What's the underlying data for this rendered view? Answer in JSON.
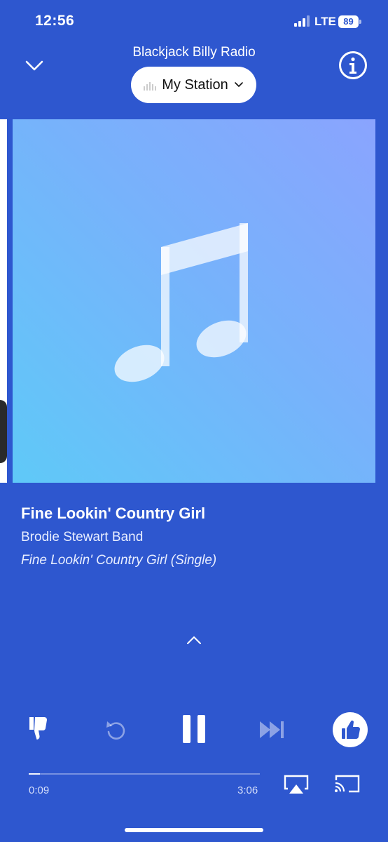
{
  "status_bar": {
    "time": "12:56",
    "network": "LTE",
    "battery": "89"
  },
  "header": {
    "station_name": "Blackjack Billy Radio",
    "station_selector": "My Station"
  },
  "artwork": {
    "icon": "music-note-icon",
    "gradient_start": "#5FC9F8",
    "gradient_end": "#8AA4FE"
  },
  "track": {
    "title": "Fine Lookin' Country Girl",
    "artist": "Brodie Stewart Band",
    "album": "Fine Lookin' Country Girl (Single)"
  },
  "player": {
    "elapsed": "0:09",
    "duration": "3:06",
    "progress_fraction": 0.048,
    "state": "playing"
  },
  "theme": {
    "background": "#2E57CF",
    "accent": "#FFFFFF"
  }
}
